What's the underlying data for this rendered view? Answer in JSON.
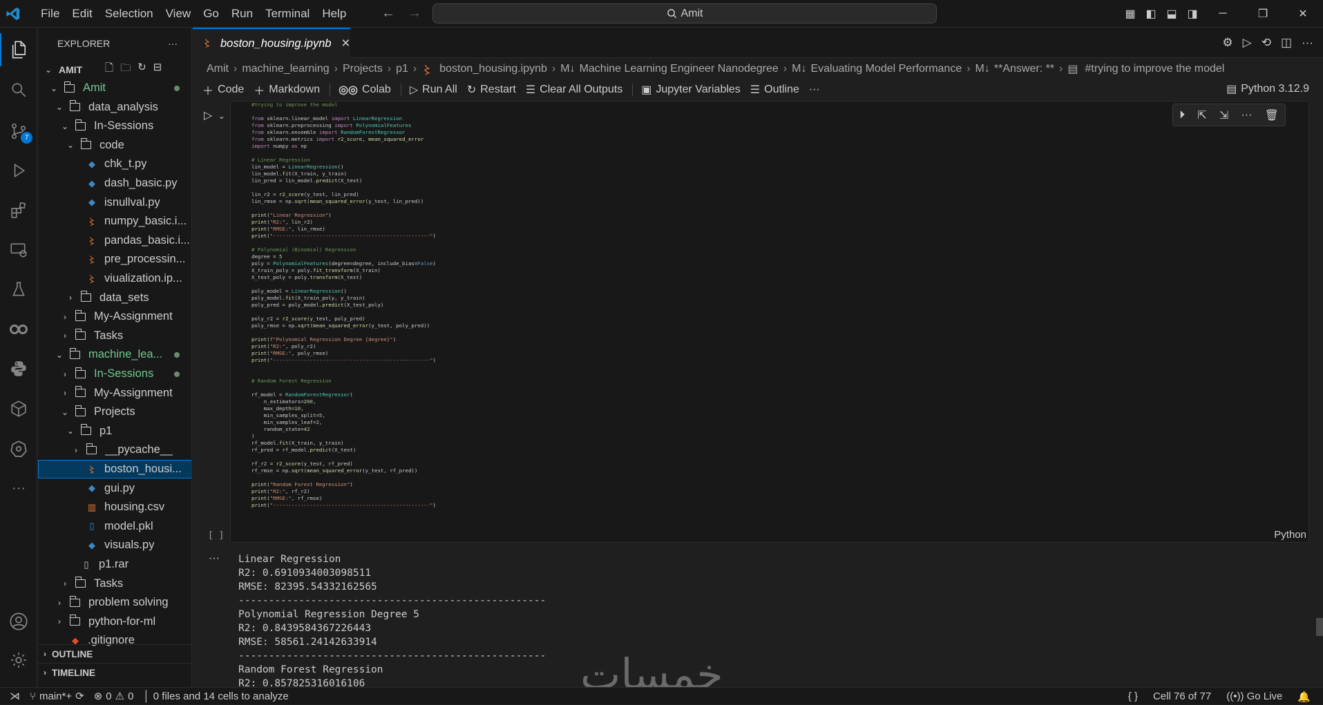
{
  "menu": [
    "File",
    "Edit",
    "Selection",
    "View",
    "Go",
    "Run",
    "Terminal",
    "Help"
  ],
  "search_text": "Amit",
  "explorer": {
    "title": "EXPLORER",
    "more": "···",
    "root": "AMIT",
    "items": [
      {
        "label": "Amit",
        "type": "folder",
        "open": true,
        "green": true,
        "dot": true
      },
      {
        "label": "data_analysis",
        "type": "folder",
        "open": true
      },
      {
        "label": "In-Sessions",
        "type": "folder",
        "open": true
      },
      {
        "label": "code",
        "type": "folder",
        "open": true
      },
      {
        "label": "chk_t.py",
        "type": "py"
      },
      {
        "label": "dash_basic.py",
        "type": "py"
      },
      {
        "label": "isnullval.py",
        "type": "py"
      },
      {
        "label": "numpy_basic.i...",
        "type": "nb"
      },
      {
        "label": "pandas_basic.i...",
        "type": "nb"
      },
      {
        "label": "pre_processin...",
        "type": "nb"
      },
      {
        "label": "viualization.ip...",
        "type": "nb"
      },
      {
        "label": "data_sets",
        "type": "folder",
        "open": false
      },
      {
        "label": "My-Assignment",
        "type": "folder",
        "open": false
      },
      {
        "label": "Tasks",
        "type": "folder",
        "open": false
      },
      {
        "label": "machine_lea...",
        "type": "folder",
        "open": true,
        "green": true,
        "dot": true
      },
      {
        "label": "In-Sessions",
        "type": "folder",
        "open": false,
        "green": true,
        "dot": true
      },
      {
        "label": "My-Assignment",
        "type": "folder",
        "open": false
      },
      {
        "label": "Projects",
        "type": "folder",
        "open": true
      },
      {
        "label": "p1",
        "type": "folder",
        "open": true
      },
      {
        "label": "__pycache__",
        "type": "folder",
        "open": false
      },
      {
        "label": "boston_housi...",
        "type": "nb",
        "selected": true
      },
      {
        "label": "gui.py",
        "type": "py"
      },
      {
        "label": "housing.csv",
        "type": "csv"
      },
      {
        "label": "model.pkl",
        "type": "pkl"
      },
      {
        "label": "visuals.py",
        "type": "py"
      },
      {
        "label": "p1.rar",
        "type": "rar"
      },
      {
        "label": "Tasks",
        "type": "folder",
        "open": false
      },
      {
        "label": "problem solving",
        "type": "folder",
        "open": false
      },
      {
        "label": "python-for-ml",
        "type": "folder",
        "open": false
      },
      {
        "label": ".gitignore",
        "type": "git"
      }
    ],
    "outline": "OUTLINE",
    "timeline": "TIMELINE"
  },
  "activity_badge": "7",
  "tab": {
    "label": "boston_housing.ipynb",
    "close": "✕"
  },
  "breadcrumb": [
    "Amit",
    "machine_learning",
    "Projects",
    "p1",
    "boston_housing.ipynb",
    "Machine Learning Engineer Nanodegree",
    "Evaluating Model Performance",
    "**Answer: **",
    "#trying to improve the model"
  ],
  "toolbar": {
    "code": "Code",
    "markdown": "Markdown",
    "colab": "Colab",
    "run_all": "Run All",
    "restart": "Restart",
    "clear": "Clear All Outputs",
    "variables": "Jupyter Variables",
    "outline": "Outline",
    "more": "···",
    "kernel": "Python 3.12.9"
  },
  "cell": {
    "exec_count": "[ ]",
    "language": "Python",
    "code_lines": [
      [
        [
          "c",
          "#trying to improve the model"
        ]
      ],
      [],
      [
        [
          "k",
          "from "
        ],
        [
          "p",
          "sklearn.linear_model "
        ],
        [
          "k",
          "import "
        ],
        [
          "cl",
          "LinearRegression"
        ]
      ],
      [
        [
          "k",
          "from "
        ],
        [
          "p",
          "sklearn.preprocessing "
        ],
        [
          "k",
          "import "
        ],
        [
          "cl",
          "PolynomialFeatures"
        ]
      ],
      [
        [
          "k",
          "from "
        ],
        [
          "p",
          "sklearn.ensemble "
        ],
        [
          "k",
          "import "
        ],
        [
          "cl",
          "RandomForestRegressor"
        ]
      ],
      [
        [
          "k",
          "from "
        ],
        [
          "p",
          "sklearn.metrics "
        ],
        [
          "k",
          "import "
        ],
        [
          "f",
          "r2_score"
        ],
        [
          "p",
          ", "
        ],
        [
          "f",
          "mean_squared_error"
        ]
      ],
      [
        [
          "k",
          "import "
        ],
        [
          "p",
          "numpy "
        ],
        [
          "k",
          "as "
        ],
        [
          "p",
          "np"
        ]
      ],
      [],
      [
        [
          "c",
          "# Linear Regression"
        ]
      ],
      [
        [
          "p",
          "lin_model = "
        ],
        [
          "cl",
          "LinearRegression"
        ],
        [
          "p",
          "()"
        ]
      ],
      [
        [
          "p",
          "lin_model."
        ],
        [
          "f",
          "fit"
        ],
        [
          "p",
          "(X_train, y_train)"
        ]
      ],
      [
        [
          "p",
          "lin_pred = lin_model."
        ],
        [
          "f",
          "predict"
        ],
        [
          "p",
          "(X_test)"
        ]
      ],
      [],
      [
        [
          "p",
          "lin_r2 = "
        ],
        [
          "f",
          "r2_score"
        ],
        [
          "p",
          "(y_test, lin_pred)"
        ]
      ],
      [
        [
          "p",
          "lin_rmse = np."
        ],
        [
          "f",
          "sqrt"
        ],
        [
          "p",
          "("
        ],
        [
          "f",
          "mean_squared_error"
        ],
        [
          "p",
          "(y_test, lin_pred))"
        ]
      ],
      [],
      [
        [
          "f",
          "print"
        ],
        [
          "p",
          "("
        ],
        [
          "s",
          "\"Linear Regression\""
        ],
        [
          "p",
          ")"
        ]
      ],
      [
        [
          "f",
          "print"
        ],
        [
          "p",
          "("
        ],
        [
          "s",
          "\"R2:\""
        ],
        [
          "p",
          ", lin_r2)"
        ]
      ],
      [
        [
          "f",
          "print"
        ],
        [
          "p",
          "("
        ],
        [
          "s",
          "\"RMSE:\""
        ],
        [
          "p",
          ", lin_rmse)"
        ]
      ],
      [
        [
          "f",
          "print"
        ],
        [
          "p",
          "("
        ],
        [
          "s",
          "\"---------------------------------------------------\""
        ],
        [
          "p",
          ")"
        ]
      ],
      [],
      [
        [
          "c",
          "# Polynomial (Binomial) Regression"
        ]
      ],
      [
        [
          "p",
          "degree = "
        ],
        [
          "n",
          "5"
        ]
      ],
      [
        [
          "p",
          "poly = "
        ],
        [
          "cl",
          "PolynomialFeatures"
        ],
        [
          "p",
          "(degree=degree, include_bias="
        ],
        [
          "b",
          "False"
        ],
        [
          "p",
          ")"
        ]
      ],
      [
        [
          "p",
          "X_train_poly = poly."
        ],
        [
          "f",
          "fit_transform"
        ],
        [
          "p",
          "(X_train)"
        ]
      ],
      [
        [
          "p",
          "X_test_poly = poly."
        ],
        [
          "f",
          "transform"
        ],
        [
          "p",
          "(X_test)"
        ]
      ],
      [],
      [
        [
          "p",
          "poly_model = "
        ],
        [
          "cl",
          "LinearRegression"
        ],
        [
          "p",
          "()"
        ]
      ],
      [
        [
          "p",
          "poly_model."
        ],
        [
          "f",
          "fit"
        ],
        [
          "p",
          "(X_train_poly, y_train)"
        ]
      ],
      [
        [
          "p",
          "poly_pred = poly_model."
        ],
        [
          "f",
          "predict"
        ],
        [
          "p",
          "(X_test_poly)"
        ]
      ],
      [],
      [
        [
          "p",
          "poly_r2 = "
        ],
        [
          "f",
          "r2_score"
        ],
        [
          "p",
          "(y_test, poly_pred)"
        ]
      ],
      [
        [
          "p",
          "poly_rmse = np."
        ],
        [
          "f",
          "sqrt"
        ],
        [
          "p",
          "("
        ],
        [
          "f",
          "mean_squared_error"
        ],
        [
          "p",
          "(y_test, poly_pred))"
        ]
      ],
      [],
      [
        [
          "f",
          "print"
        ],
        [
          "p",
          "("
        ],
        [
          "s",
          "f\"Polynomial Regression Degree {degree}\""
        ],
        [
          "p",
          ")"
        ]
      ],
      [
        [
          "f",
          "print"
        ],
        [
          "p",
          "("
        ],
        [
          "s",
          "\"R2:\""
        ],
        [
          "p",
          ", poly_r2)"
        ]
      ],
      [
        [
          "f",
          "print"
        ],
        [
          "p",
          "("
        ],
        [
          "s",
          "\"RMSE:\""
        ],
        [
          "p",
          ", poly_rmse)"
        ]
      ],
      [
        [
          "f",
          "print"
        ],
        [
          "p",
          "("
        ],
        [
          "s",
          "\"---------------------------------------------------\""
        ],
        [
          "p",
          ")"
        ]
      ],
      [],
      [],
      [
        [
          "c",
          "# Random Forest Regression"
        ]
      ],
      [],
      [
        [
          "p",
          "rf_model = "
        ],
        [
          "cl",
          "RandomForestRegressor"
        ],
        [
          "p",
          "("
        ]
      ],
      [
        [
          "p",
          "    n_estimators="
        ],
        [
          "n",
          "200"
        ],
        [
          "p",
          ","
        ]
      ],
      [
        [
          "p",
          "    max_depth="
        ],
        [
          "n",
          "10"
        ],
        [
          "p",
          ","
        ]
      ],
      [
        [
          "p",
          "    min_samples_split="
        ],
        [
          "n",
          "5"
        ],
        [
          "p",
          ","
        ]
      ],
      [
        [
          "p",
          "    min_samples_leaf="
        ],
        [
          "n",
          "2"
        ],
        [
          "p",
          ","
        ]
      ],
      [
        [
          "p",
          "    random_state="
        ],
        [
          "n",
          "42"
        ]
      ],
      [
        [
          "p",
          ")"
        ]
      ],
      [
        [
          "p",
          "rf_model."
        ],
        [
          "f",
          "fit"
        ],
        [
          "p",
          "(X_train, y_train)"
        ]
      ],
      [
        [
          "p",
          "rf_pred = rf_model."
        ],
        [
          "f",
          "predict"
        ],
        [
          "p",
          "(X_test)"
        ]
      ],
      [],
      [
        [
          "p",
          "rf_r2 = "
        ],
        [
          "f",
          "r2_score"
        ],
        [
          "p",
          "(y_test, rf_pred)"
        ]
      ],
      [
        [
          "p",
          "rf_rmse = np."
        ],
        [
          "f",
          "sqrt"
        ],
        [
          "p",
          "("
        ],
        [
          "f",
          "mean_squared_error"
        ],
        [
          "p",
          "(y_test, rf_pred))"
        ]
      ],
      [],
      [
        [
          "f",
          "print"
        ],
        [
          "p",
          "("
        ],
        [
          "s",
          "\"Random Forest Regression\""
        ],
        [
          "p",
          ")"
        ]
      ],
      [
        [
          "f",
          "print"
        ],
        [
          "p",
          "("
        ],
        [
          "s",
          "\"R2:\""
        ],
        [
          "p",
          ", rf_r2)"
        ]
      ],
      [
        [
          "f",
          "print"
        ],
        [
          "p",
          "("
        ],
        [
          "s",
          "\"RMSE:\""
        ],
        [
          "p",
          ", rf_rmse)"
        ]
      ],
      [
        [
          "f",
          "print"
        ],
        [
          "p",
          "("
        ],
        [
          "s",
          "\"---------------------------------------------------\""
        ],
        [
          "p",
          ")"
        ]
      ]
    ]
  },
  "output": {
    "dots": "···",
    "lines": [
      "Linear Regression",
      "R2: 0.6910934003098511",
      "RMSE: 82395.54332162565",
      "---------------------------------------------------",
      "Polynomial Regression Degree 5",
      "R2: 0.8439584367226443",
      "RMSE: 58561.24142633914",
      "---------------------------------------------------",
      "Random Forest Regression",
      "R2: 0.857825316016106"
    ]
  },
  "status": {
    "branch": "main*+",
    "errors": "0",
    "warnings": "0",
    "analysis": "0 files and 14 cells to analyze",
    "braces": "{ }",
    "cell_pos": "Cell 76 of 77",
    "golive": "Go Live"
  },
  "watermark": "خمسات"
}
